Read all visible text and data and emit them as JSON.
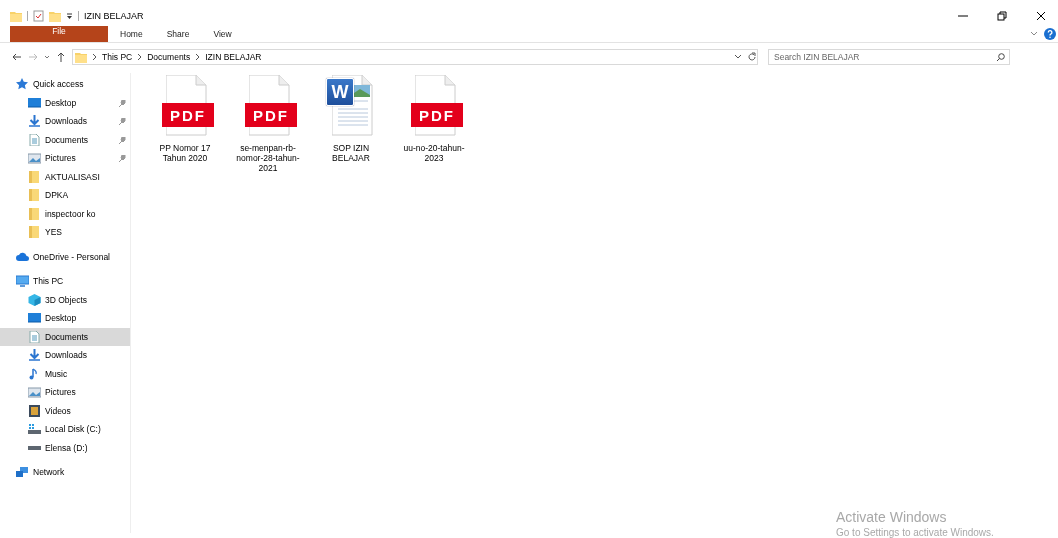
{
  "window": {
    "title": "IZIN BELAJAR"
  },
  "ribbon": {
    "tabs": [
      {
        "label": "File",
        "kind": "file",
        "selected": false
      },
      {
        "label": "Home",
        "kind": "tab",
        "selected": false
      },
      {
        "label": "Share",
        "kind": "tab",
        "selected": false
      },
      {
        "label": "View",
        "kind": "tab",
        "selected": false
      }
    ]
  },
  "address": {
    "path": [
      "This PC",
      "Documents",
      "IZIN BELAJAR"
    ]
  },
  "search": {
    "placeholder": "Search IZIN BELAJAR"
  },
  "sidebar": {
    "items": [
      {
        "label": "Quick access",
        "kind": "star",
        "selected": false,
        "children": [
          {
            "label": "Desktop",
            "kind": "desktop",
            "pinned": true,
            "selected": false
          },
          {
            "label": "Downloads",
            "kind": "download",
            "pinned": true,
            "selected": false
          },
          {
            "label": "Documents",
            "kind": "document",
            "pinned": true,
            "selected": false
          },
          {
            "label": "Pictures",
            "kind": "pictures",
            "pinned": true,
            "selected": false
          },
          {
            "label": "AKTUALISASI",
            "kind": "folder",
            "pinned": false,
            "selected": false
          },
          {
            "label": "DPKA",
            "kind": "folder",
            "pinned": false,
            "selected": false
          },
          {
            "label": "inspectoor ko",
            "kind": "folder",
            "pinned": false,
            "selected": false
          },
          {
            "label": "YES",
            "kind": "folder",
            "pinned": false,
            "selected": false
          }
        ]
      },
      {
        "label": "OneDrive - Personal",
        "kind": "cloud",
        "selected": false
      },
      {
        "label": "This PC",
        "kind": "pc",
        "selected": false,
        "children": [
          {
            "label": "3D Objects",
            "kind": "cube",
            "selected": false
          },
          {
            "label": "Desktop",
            "kind": "desktop",
            "selected": false
          },
          {
            "label": "Documents",
            "kind": "document",
            "selected": true
          },
          {
            "label": "Downloads",
            "kind": "download",
            "selected": false
          },
          {
            "label": "Music",
            "kind": "music",
            "selected": false
          },
          {
            "label": "Pictures",
            "kind": "pictures",
            "selected": false
          },
          {
            "label": "Videos",
            "kind": "video",
            "selected": false
          },
          {
            "label": "Local Disk (C:)",
            "kind": "drive-c",
            "selected": false
          },
          {
            "label": "Elensa (D:)",
            "kind": "drive",
            "selected": false
          }
        ]
      },
      {
        "label": "Network",
        "kind": "network",
        "selected": false
      }
    ]
  },
  "files": [
    {
      "name": "PP Nomor 17 Tahun 2020",
      "kind": "pdf",
      "badge": "PDF"
    },
    {
      "name": "se-menpan-rb-nomor-28-tahun-2021",
      "kind": "pdf",
      "badge": "PDF"
    },
    {
      "name": "SOP IZIN BELAJAR",
      "kind": "word",
      "badge": "W"
    },
    {
      "name": "uu-no-20-tahun-2023",
      "kind": "pdf",
      "badge": "PDF"
    }
  ],
  "activation": {
    "title": "Activate Windows",
    "message": "Go to Settings to activate Windows."
  }
}
